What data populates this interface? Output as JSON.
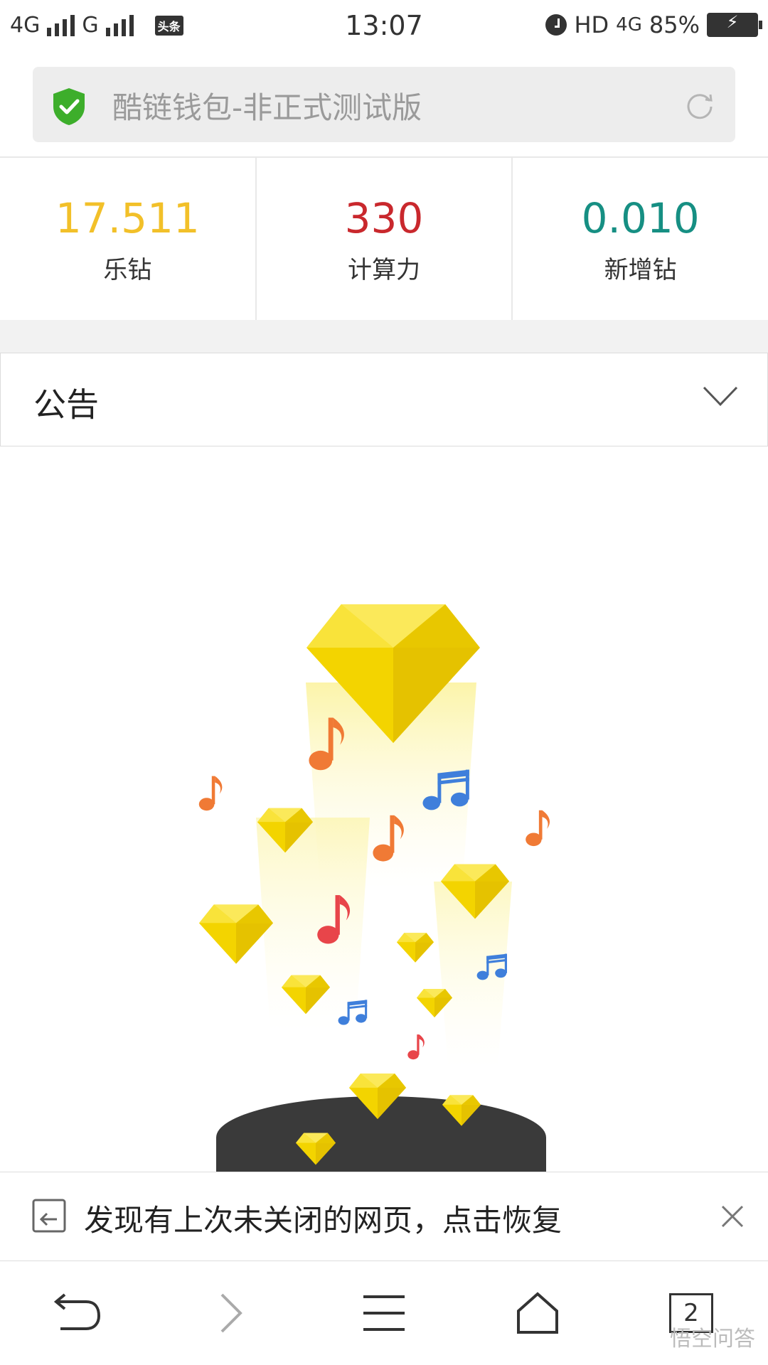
{
  "status_bar": {
    "network_left": "4G",
    "network_mid": "G",
    "app_badge": "头条",
    "time": "13:07",
    "hd_label": "HD",
    "network_right": "4G",
    "battery": "85%"
  },
  "address_bar": {
    "title": "酷链钱包-非正式测试版",
    "secure_icon": "shield-check-icon",
    "refresh_icon": "refresh-icon"
  },
  "stats": [
    {
      "value": "17.511",
      "label": "乐钻",
      "color": "#f2c029"
    },
    {
      "value": "330",
      "label": "计算力",
      "color": "#c9282d"
    },
    {
      "value": "0.010",
      "label": "新增钻",
      "color": "#168f83"
    }
  ],
  "notice": {
    "title": "公告",
    "icon": "chevron-down-icon"
  },
  "restore_bar": {
    "text": "发现有上次未关闭的网页，点击恢复",
    "icon": "restore-page-icon",
    "close_icon": "close-icon"
  },
  "bottom_nav": {
    "back_icon": "back-icon",
    "forward_icon": "forward-icon",
    "menu_icon": "menu-icon",
    "home_icon": "home-icon",
    "tab_count": "2"
  },
  "watermark": "悟空问答",
  "colors": {
    "gem_yellow": "#f7d800",
    "note_orange": "#f07a35",
    "note_blue": "#3f7fdb",
    "note_red": "#e8454a"
  }
}
